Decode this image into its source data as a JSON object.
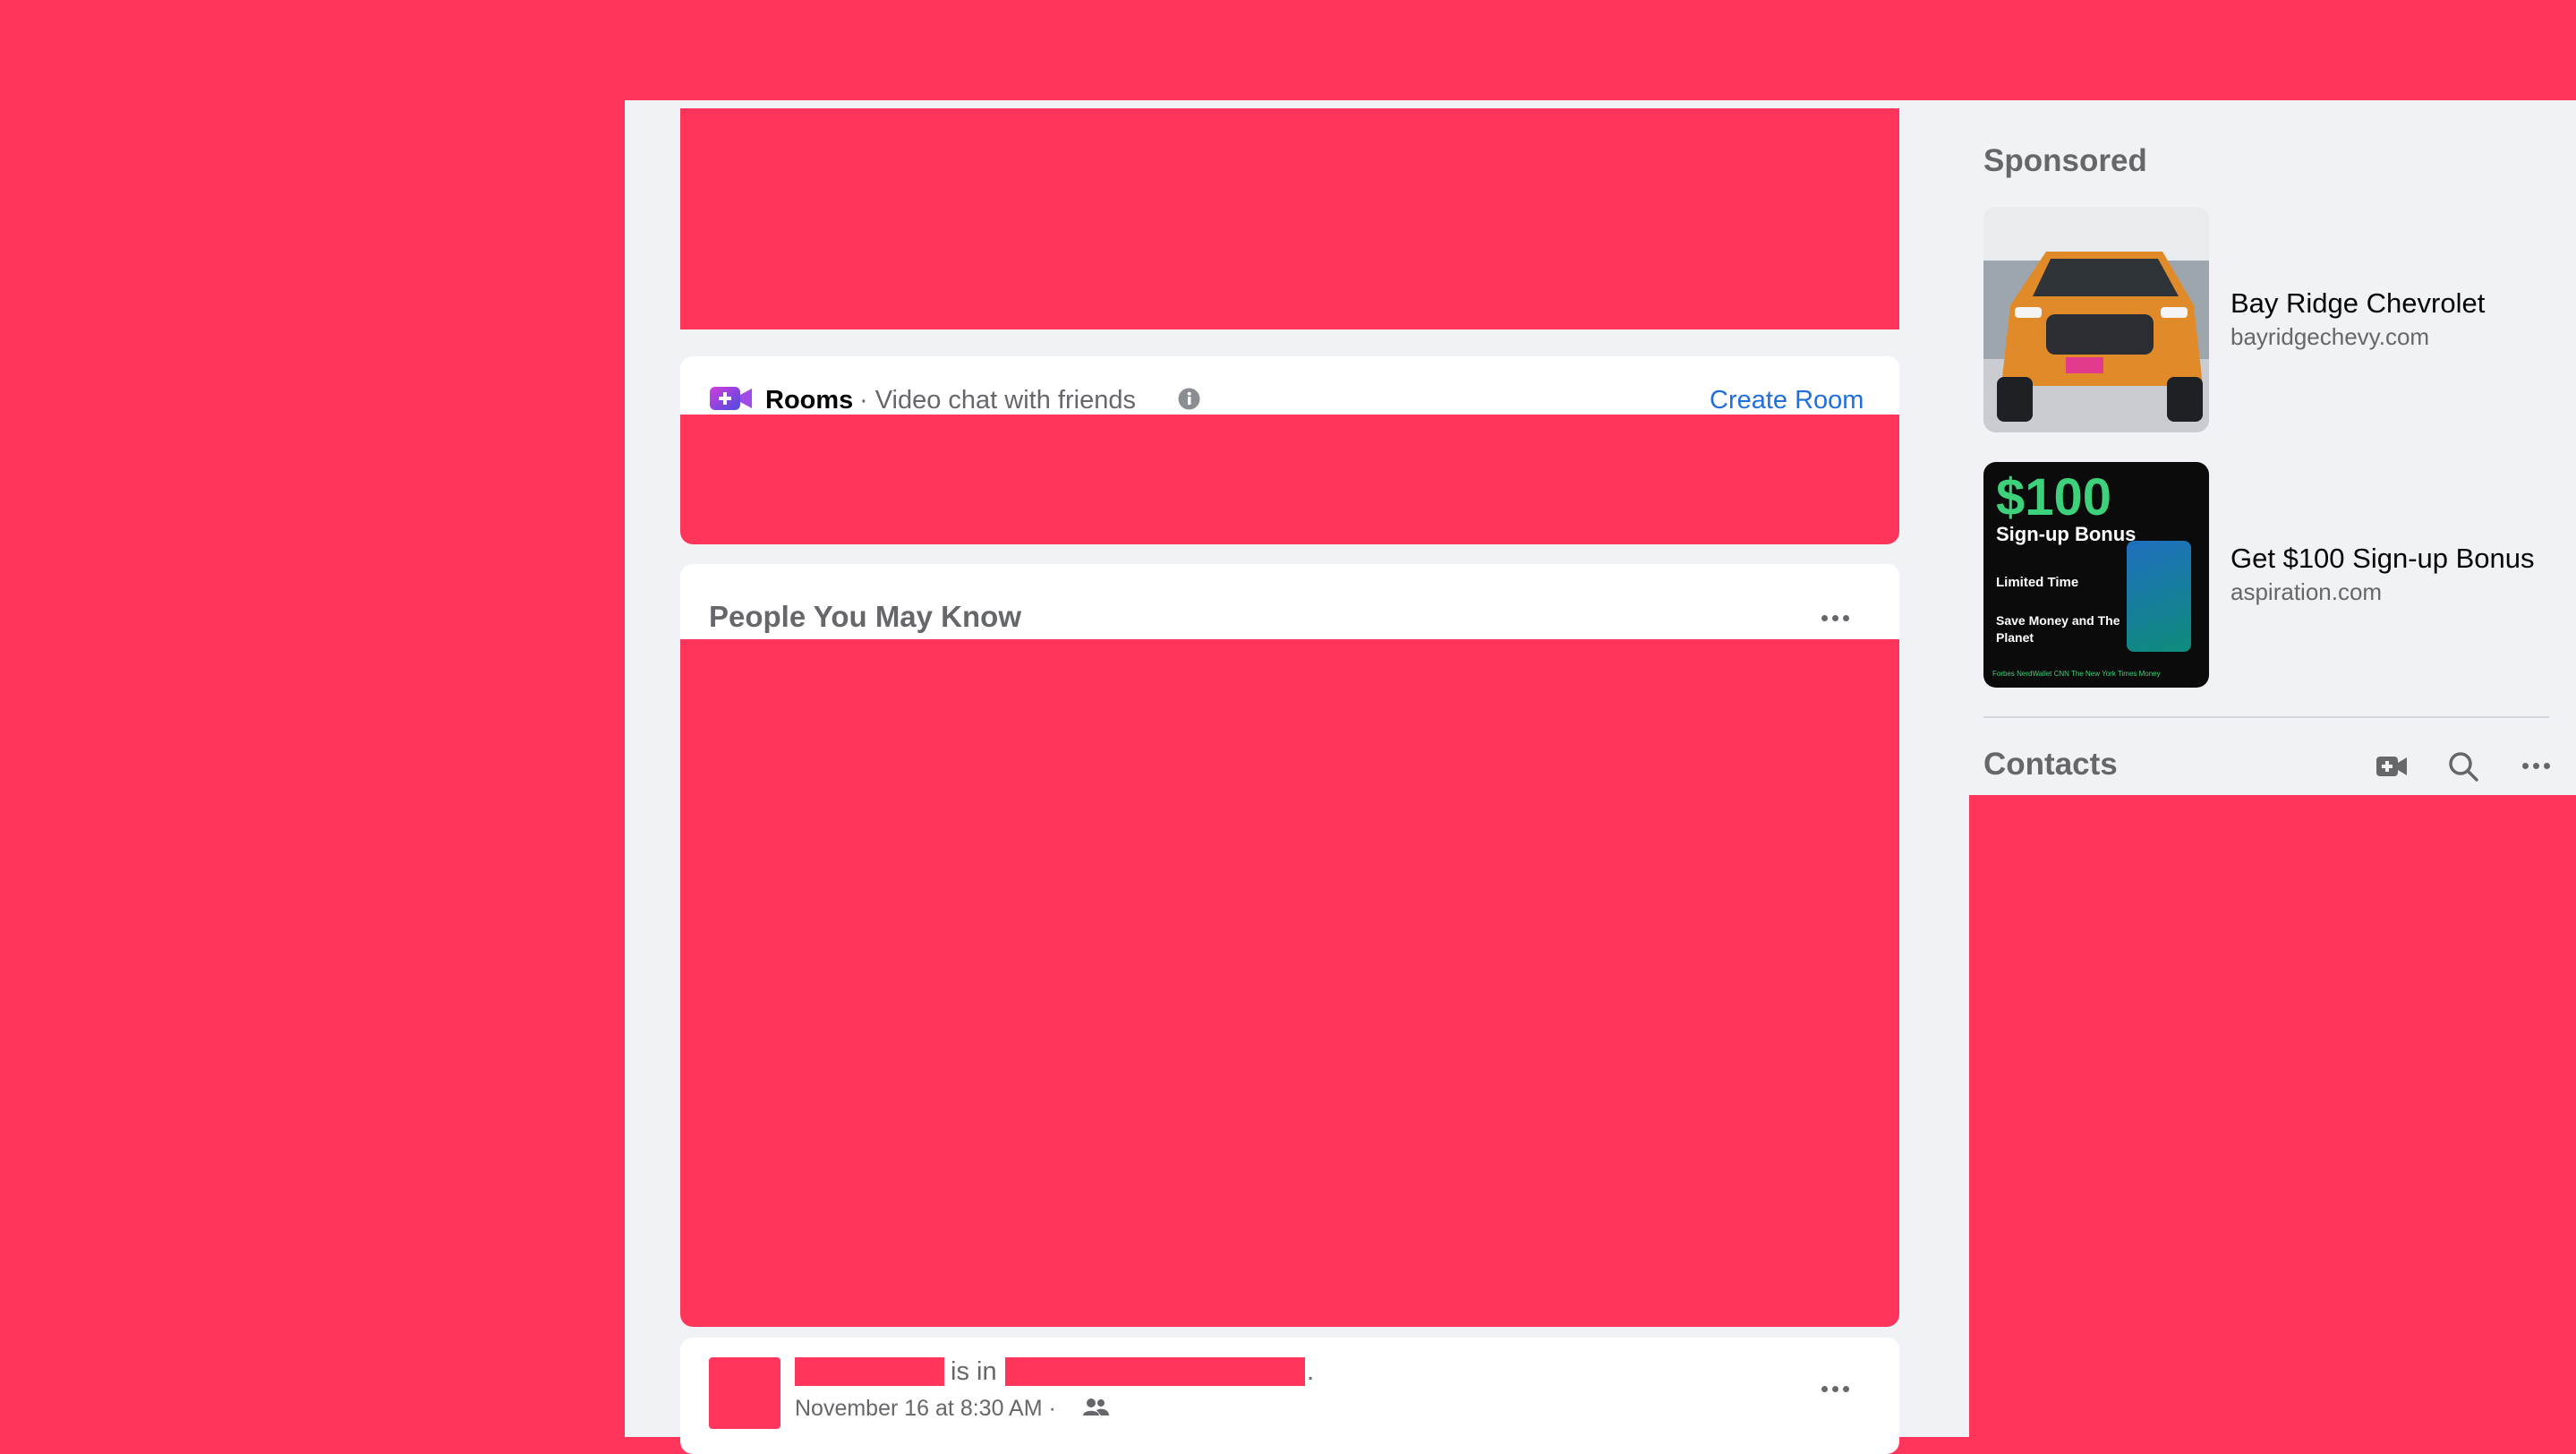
{
  "rooms": {
    "title": "Rooms",
    "subtitle": "· Video chat with friends",
    "info_icon": "info-icon",
    "camera_icon": "video-camera-plus-icon",
    "create_label": "Create Room"
  },
  "pymk": {
    "title": "People You May Know",
    "more_icon": "more-horizontal-icon"
  },
  "post": {
    "connector": "is in",
    "period": ".",
    "timestamp": "November 16 at 8:30 AM ·",
    "audience_icon": "friends-icon",
    "more_icon": "more-horizontal-icon"
  },
  "sponsored": {
    "title": "Sponsored",
    "ads": [
      {
        "title": "Bay Ridge Chevrolet",
        "domain": "bayridgechevy.com",
        "image": "orange-suv-image"
      },
      {
        "title": "Get $100 Sign-up Bonus",
        "domain": "aspiration.com",
        "image": "aspiration-card-ad",
        "image_text": {
          "amount": "$100",
          "bonus": "Sign-up Bonus",
          "limited": "Limited Time",
          "save": "Save Money and The Planet",
          "logos": "Forbes  NerdWallet  CNN  The New York Times  Money"
        }
      }
    ]
  },
  "contacts": {
    "title": "Contacts",
    "icons": [
      "new-room-icon",
      "search-icon",
      "more-horizontal-icon"
    ]
  },
  "colors": {
    "redaction": "#FF355B",
    "feed_background": "#F0F2F5",
    "link_blue": "#216FDB",
    "secondary_text": "#65676B"
  }
}
